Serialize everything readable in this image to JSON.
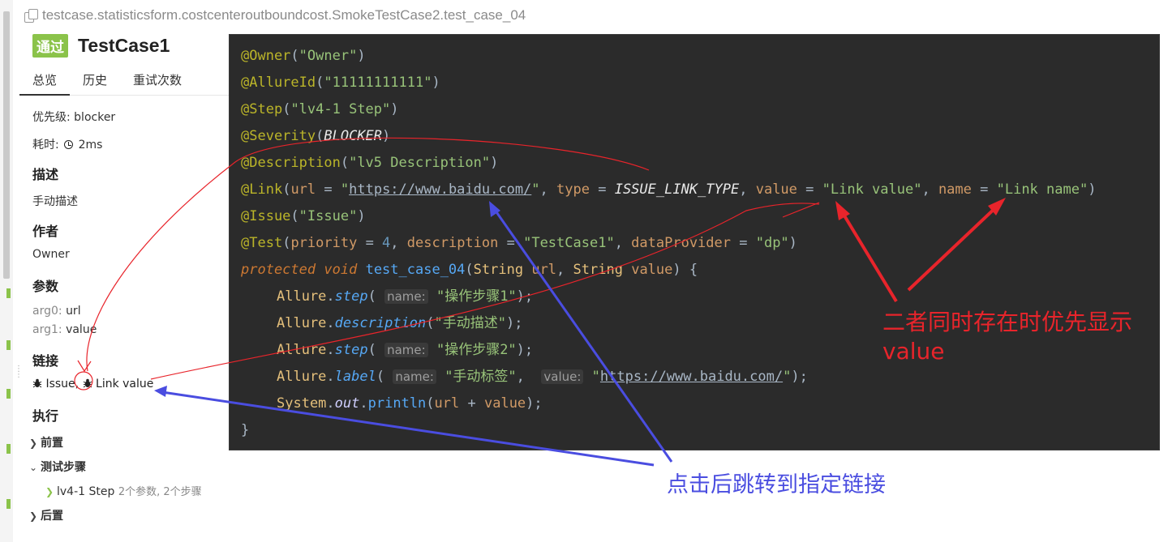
{
  "path": "testcase.statisticsform.costcenteroutboundcost.SmokeTestCase2.test_case_04",
  "status_badge": "通过",
  "title": "TestCase1",
  "tabs": [
    "总览",
    "历史",
    "重试次数"
  ],
  "details": {
    "priority_label": "优先级:",
    "priority_value": "blocker",
    "duration_label": "耗时:",
    "duration_value": "2ms",
    "description_title": "描述",
    "description_value": "手动描述",
    "author_title": "作者",
    "author_value": "Owner",
    "params_title": "参数",
    "params": [
      {
        "name": "arg0:",
        "value": "url"
      },
      {
        "name": "arg1:",
        "value": "value"
      }
    ],
    "links_title": "链接",
    "links": [
      "Issue",
      "Link value"
    ],
    "links_separator": ",",
    "execution_title": "执行",
    "setup": "前置",
    "test_steps": "测试步骤",
    "step_name": "lv4-1 Step",
    "step_meta": "2个参数, 2个步骤",
    "teardown": "后置"
  },
  "code": {
    "owner_ann": "@Owner",
    "owner_val": "\"Owner\"",
    "allure_ann": "@AllureId",
    "allure_val": "\"11111111111\"",
    "step_ann": "@Step",
    "step_val": "\"lv4-1 Step\"",
    "severity_ann": "@Severity",
    "severity_val": "BLOCKER",
    "desc_ann": "@Description",
    "desc_val": "\"lv5 Description\"",
    "link_ann": "@Link",
    "link_url_key": "url",
    "link_url": "https://www.baidu.com/",
    "link_type_key": "type",
    "link_type": "ISSUE_LINK_TYPE",
    "link_value_key": "value",
    "link_value": "\"Link value\"",
    "link_name_key": "name",
    "link_name": "\"Link name\"",
    "issue_ann": "@Issue",
    "issue_val": "\"Issue\"",
    "test_ann": "@Test",
    "test_priority_key": "priority",
    "test_priority": "4",
    "test_desc_key": "description",
    "test_desc": "\"TestCase1\"",
    "test_dp_key": "dataProvider",
    "test_dp": "\"dp\"",
    "kw_protected": "protected",
    "kw_void": "void",
    "method_name": "test_case_04",
    "type_string": "String",
    "param_url": "url",
    "param_value": "value",
    "allure_cls": "Allure",
    "call_step": "step",
    "call_description": "description",
    "call_label": "label",
    "hint_name": "name:",
    "hint_value": "value:",
    "step1": "\"操作步骤1\"",
    "manual_desc": "\"手动描述\"",
    "step2": "\"操作步骤2\"",
    "label_name": "\"手动标签\"",
    "label_url": "https://www.baidu.com/",
    "system_cls": "System",
    "out_field": "out",
    "println": "println",
    "close_brace": "}"
  },
  "annotations": {
    "red_line1": "二者同时存在时优先显示",
    "red_line2": "value",
    "blue": "点击后跳转到指定链接",
    "red_color": "#e8242b",
    "blue_color": "#4a4de0"
  }
}
